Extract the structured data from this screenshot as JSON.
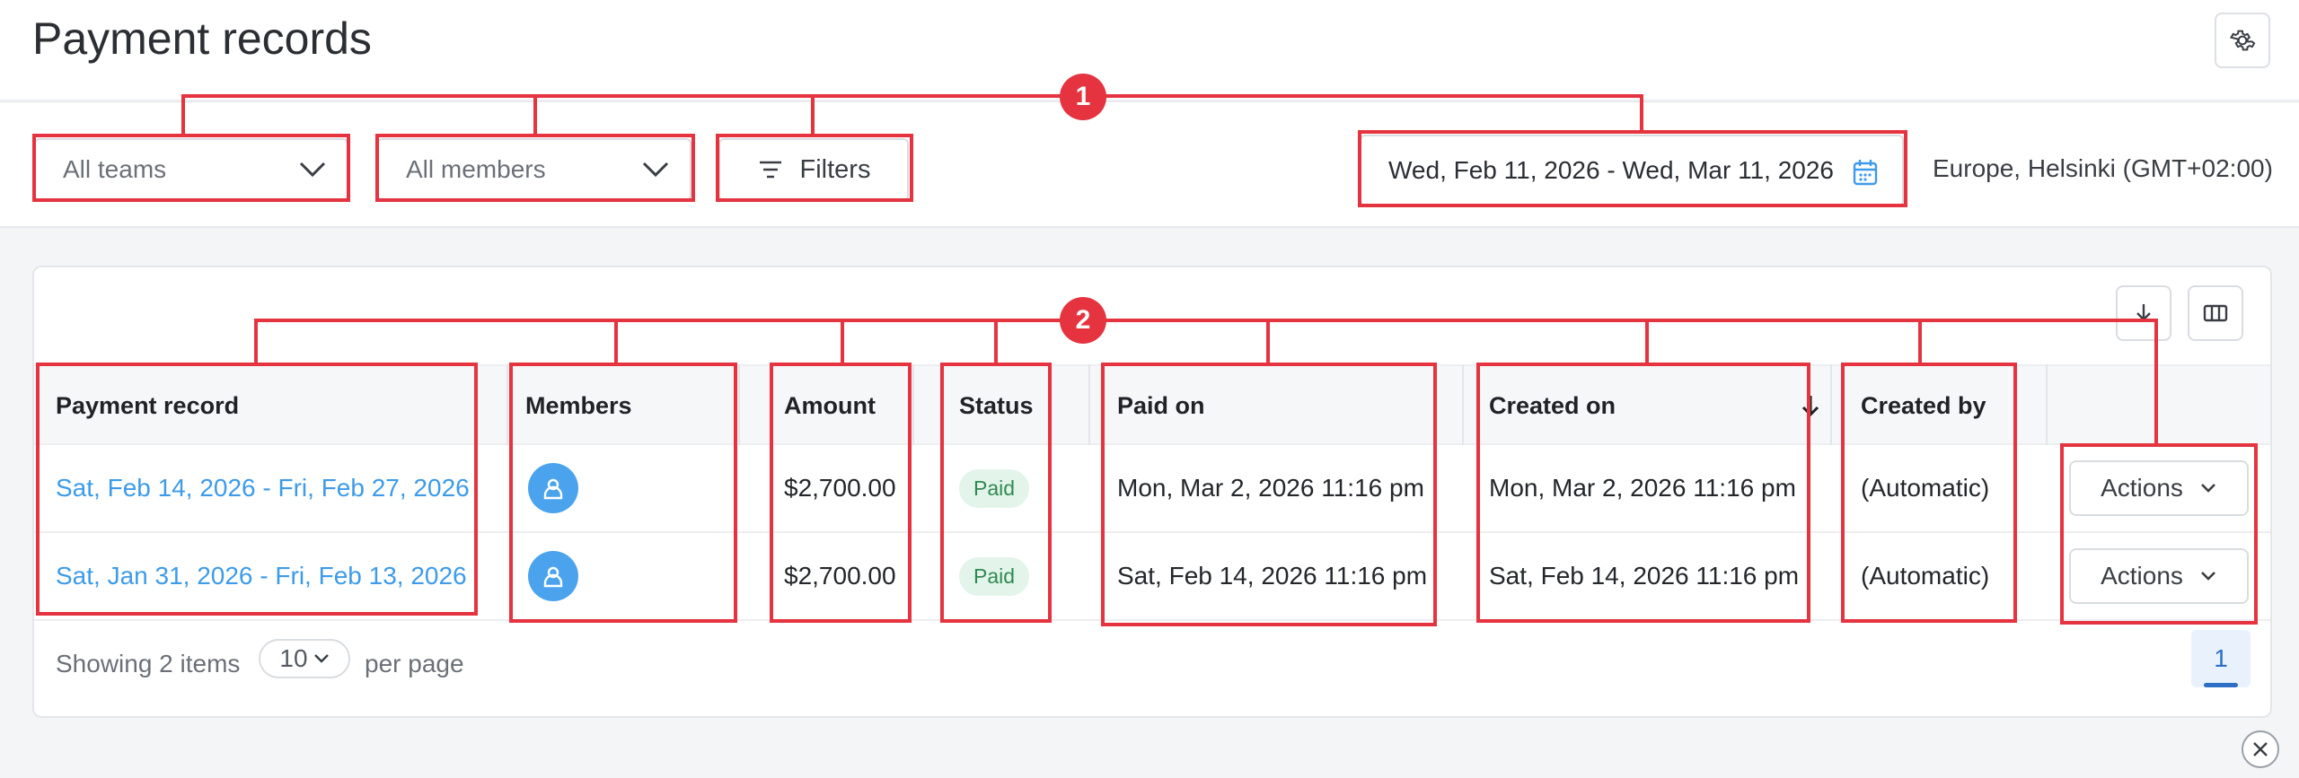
{
  "header": {
    "title": "Payment records",
    "settings_icon": "gear-icon"
  },
  "toolbar": {
    "teams": "All teams",
    "members": "All members",
    "filters": "Filters",
    "date_range": "Wed, Feb 11, 2026 - Wed, Mar 11, 2026",
    "timezone": "Europe, Helsinki (GMT+02:00)"
  },
  "table": {
    "columns": [
      "Payment record",
      "Members",
      "Amount",
      "Status",
      "Paid on",
      "Created on",
      "Created by"
    ],
    "sort_column": "Created on",
    "sort_direction": "descending",
    "rows": [
      {
        "record": "Sat, Feb 14, 2026 - Fri, Feb 27, 2026",
        "amount": "$2,700.00",
        "status": "Paid",
        "paid_on": "Mon, Mar 2, 2026 11:16 pm",
        "created_on": "Mon, Mar 2, 2026 11:16 pm",
        "created_by": "(Automatic)",
        "actions": "Actions"
      },
      {
        "record": "Sat, Jan 31, 2026 - Fri, Feb 13, 2026",
        "amount": "$2,700.00",
        "status": "Paid",
        "paid_on": "Sat, Feb 14, 2026 11:16 pm",
        "created_on": "Sat, Feb 14, 2026 11:16 pm",
        "created_by": "(Automatic)",
        "actions": "Actions"
      }
    ]
  },
  "footer": {
    "showing": "Showing 2 items",
    "per_page_value": "10",
    "per_page_label": "per page",
    "current_page": "1"
  },
  "annotations": {
    "marker_1": "1",
    "marker_2": "2"
  },
  "colors": {
    "accent": "#3d9be9",
    "annotation": "#e5333f",
    "paid_bg": "#e3f4ea",
    "paid_text": "#2f8a52"
  }
}
